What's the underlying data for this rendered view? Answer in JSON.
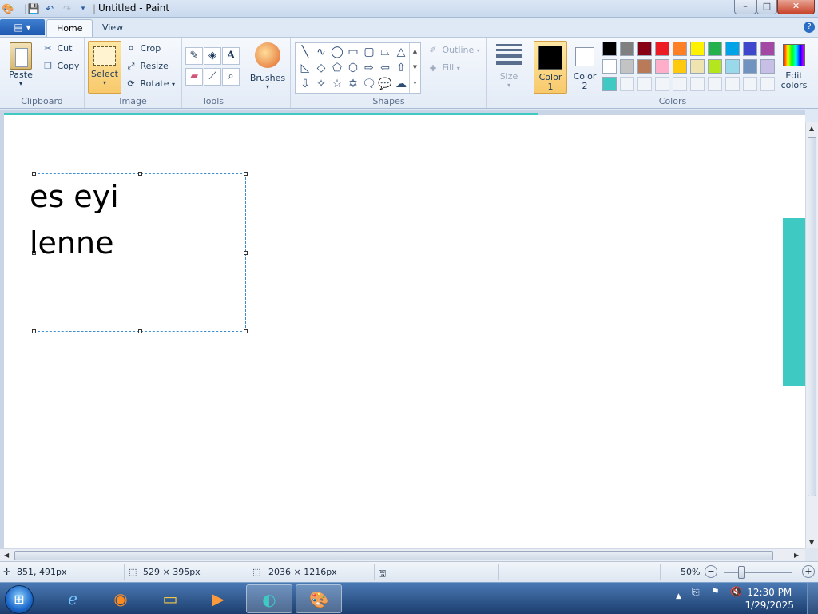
{
  "window": {
    "title": "Untitled - Paint",
    "minimize": "–",
    "maximize": "□",
    "close": "✕"
  },
  "quick_access": {
    "app_icon": "paint-icon",
    "save_icon": "save-icon",
    "undo_icon": "undo-icon",
    "redo_icon": "redo-icon",
    "customize_icon": "dropdown-icon"
  },
  "tabs": [
    {
      "label": "Home",
      "active": true
    },
    {
      "label": "View",
      "active": false
    }
  ],
  "ribbon": {
    "clipboard": {
      "label": "Clipboard",
      "paste": "Paste",
      "cut": "Cut",
      "copy": "Copy"
    },
    "image": {
      "label": "Image",
      "select": "Select",
      "crop": "Crop",
      "resize": "Resize",
      "rotate": "Rotate"
    },
    "tools": {
      "label": "Tools"
    },
    "brushes": {
      "label": "Brushes"
    },
    "shapes": {
      "label": "Shapes",
      "outline": "Outline",
      "fill": "Fill"
    },
    "size": {
      "label": "Size"
    },
    "colors": {
      "label": "Colors",
      "color1_line1": "Color",
      "color1_line2": "1",
      "color2_line1": "Color",
      "color2_line2": "2",
      "edit_line1": "Edit",
      "edit_line2": "colors",
      "color1_value": "#000000",
      "color2_value": "#ffffff",
      "palette_row1": [
        "#000000",
        "#7f7f7f",
        "#880015",
        "#ed1c24",
        "#ff7f27",
        "#fff200",
        "#22b14c",
        "#00a2e8",
        "#3f48cc",
        "#a349a4"
      ],
      "palette_row2": [
        "#ffffff",
        "#c3c3c3",
        "#b97a57",
        "#ffaec9",
        "#ffc90e",
        "#efe4b0",
        "#b5e61d",
        "#99d9ea",
        "#7092be",
        "#c8bfe7"
      ],
      "palette_row3": [
        "#3ec9c3"
      ]
    }
  },
  "canvas": {
    "text_line1": "es eyi",
    "text_line2": "lenne",
    "accent": "#3ec9c3"
  },
  "status": {
    "cursor_pos": "851, 491px",
    "selection_size": "529 × 395px",
    "image_size": "2036 × 1216px",
    "zoom": "50%"
  },
  "taskbar": {
    "time": "12:30 PM",
    "date": "1/29/2025"
  }
}
